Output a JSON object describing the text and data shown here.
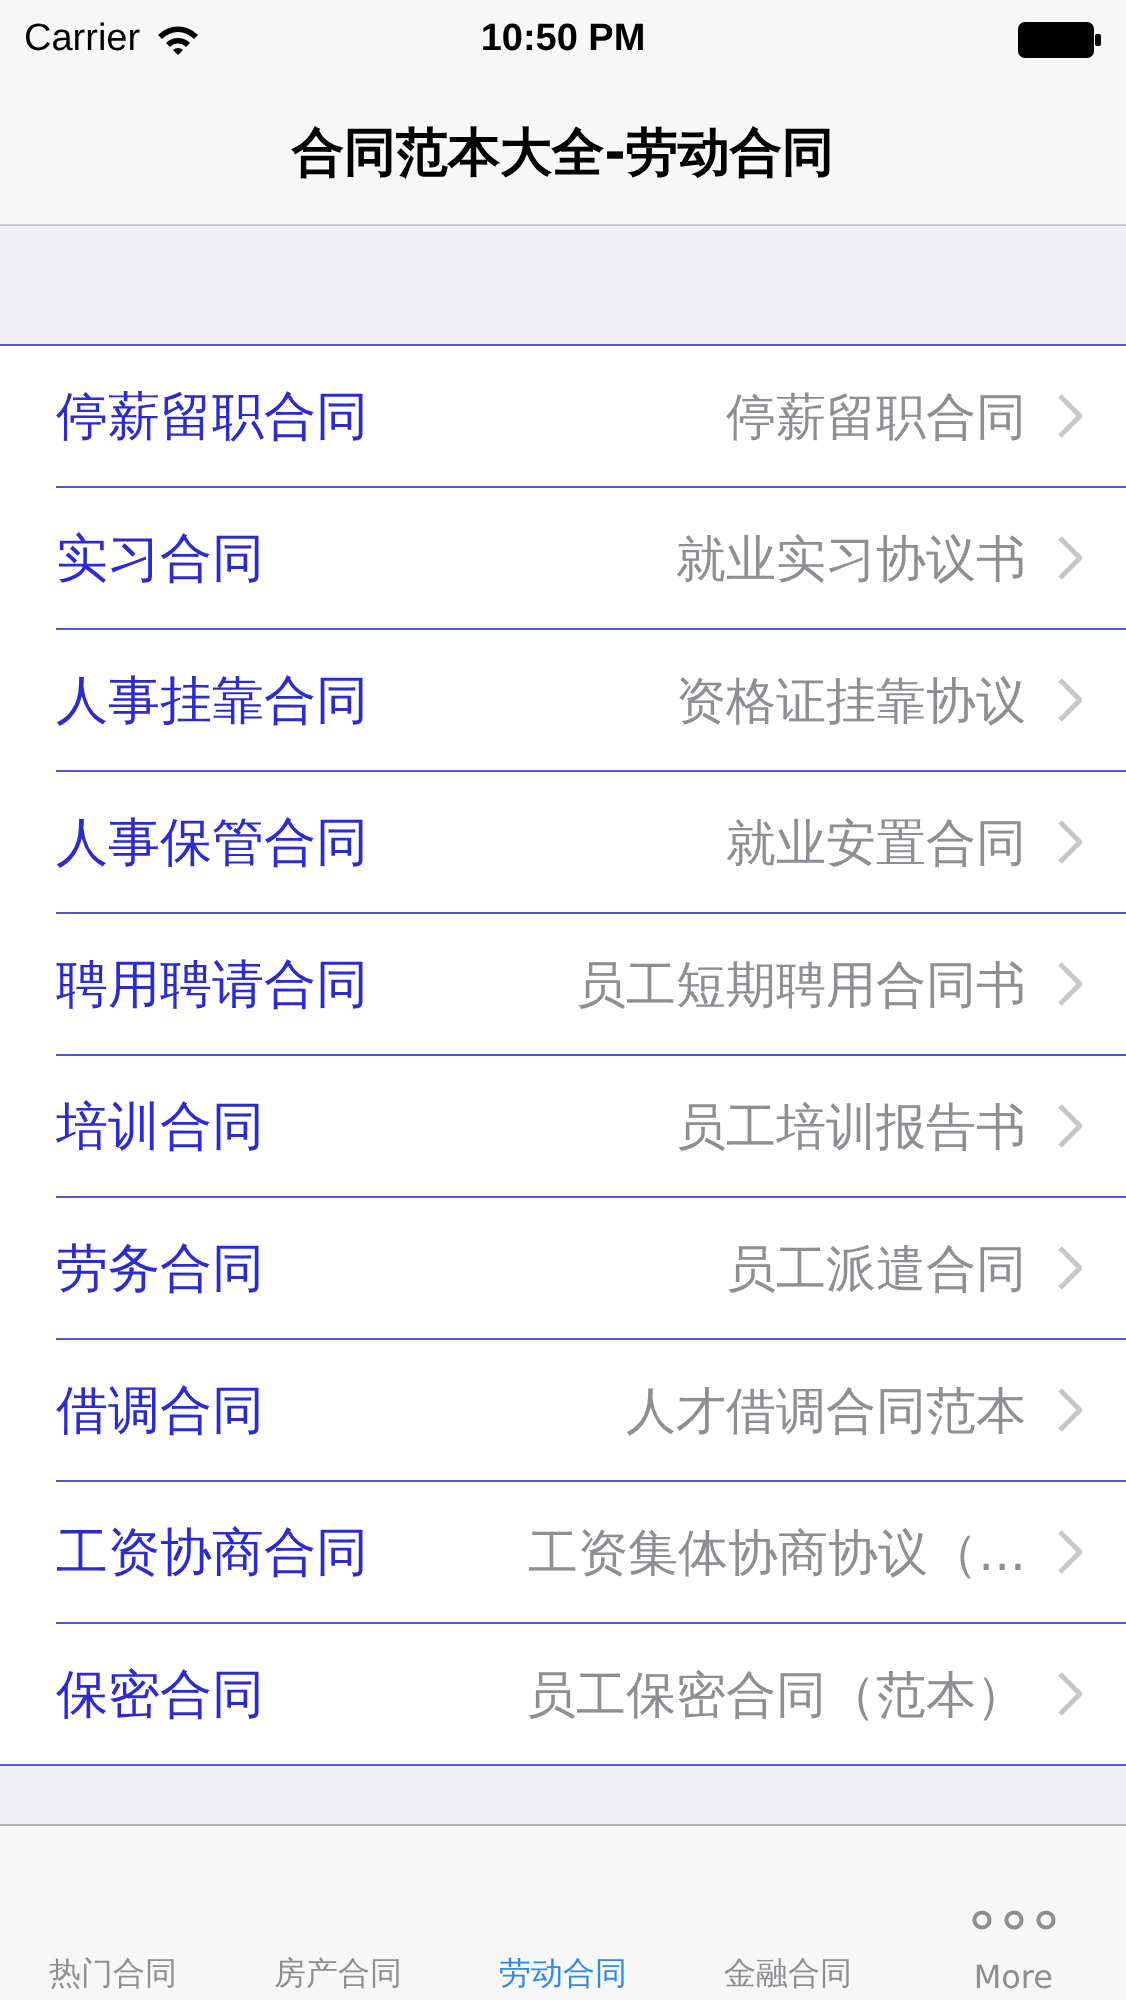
{
  "status_bar": {
    "carrier": "Carrier",
    "time": "10:50 PM"
  },
  "nav_bar": {
    "title": "合同范本大全-劳动合同"
  },
  "rows": [
    {
      "title": "停薪留职合同",
      "detail": "停薪留职合同"
    },
    {
      "title": "实习合同",
      "detail": "就业实习协议书"
    },
    {
      "title": "人事挂靠合同",
      "detail": "资格证挂靠协议"
    },
    {
      "title": "人事保管合同",
      "detail": "就业安置合同"
    },
    {
      "title": "聘用聘请合同",
      "detail": "员工短期聘用合同书"
    },
    {
      "title": "培训合同",
      "detail": "员工培训报告书"
    },
    {
      "title": "劳务合同",
      "detail": "员工派遣合同"
    },
    {
      "title": "借调合同",
      "detail": "人才借调合同范本"
    },
    {
      "title": "工资协商合同",
      "detail": "工资集体协商协议（..."
    },
    {
      "title": "保密合同",
      "detail": "员工保密合同（范本）"
    }
  ],
  "tab_bar": [
    {
      "label": "热门合同",
      "selected": false,
      "kind": "plain"
    },
    {
      "label": "房产合同",
      "selected": false,
      "kind": "plain"
    },
    {
      "label": "劳动合同",
      "selected": true,
      "kind": "plain"
    },
    {
      "label": "金融合同",
      "selected": false,
      "kind": "plain"
    },
    {
      "label": "More",
      "selected": false,
      "kind": "more"
    }
  ]
}
